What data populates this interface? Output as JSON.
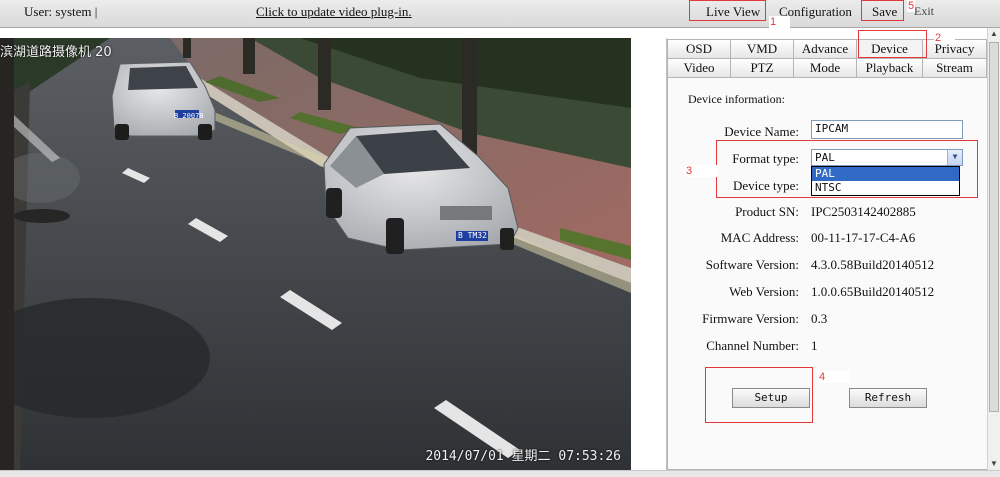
{
  "topbar": {
    "user": "User: system |",
    "plugin_link": "Click to update video plug-in.",
    "live_view": "Live View",
    "configuration": "Configuration",
    "save": "Save",
    "exit": "Exit"
  },
  "annotations": {
    "n1": "1",
    "n2": "2",
    "n3": "3",
    "n4": "4",
    "n5": "5"
  },
  "video": {
    "title": "滨湖道路摄像机 20",
    "timestamp": "2014/07/01 星期二 07:53:26",
    "plate_front": "B 20078",
    "plate_near": "B TM32"
  },
  "tabs": {
    "row1": [
      "OSD",
      "VMD",
      "Advance",
      "Device",
      "Privacy"
    ],
    "row2": [
      "Video",
      "PTZ",
      "Mode",
      "Playback",
      "Stream"
    ],
    "active": "Device"
  },
  "device": {
    "heading": "Device information:",
    "name_label": "Device Name:",
    "name_value": "IPCAM",
    "format_label": "Format type:",
    "format_value": "PAL",
    "format_options": [
      "PAL",
      "NTSC"
    ],
    "type_label": "Device type:",
    "sn_label": "Product SN:",
    "sn_value": "IPC2503142402885",
    "mac_label": "MAC Address:",
    "mac_value": "00-11-17-17-C4-A6",
    "sw_label": "Software Version:",
    "sw_value": "4.3.0.58Build20140512",
    "web_label": "Web Version:",
    "web_value": "1.0.0.65Build20140512",
    "fw_label": "Firmware Version:",
    "fw_value": "0.3",
    "ch_label": "Channel Number:",
    "ch_value": "1",
    "setup": "Setup",
    "refresh": "Refresh"
  },
  "colors": {
    "annotation": "#e23a3a",
    "selection": "#316ac5"
  }
}
